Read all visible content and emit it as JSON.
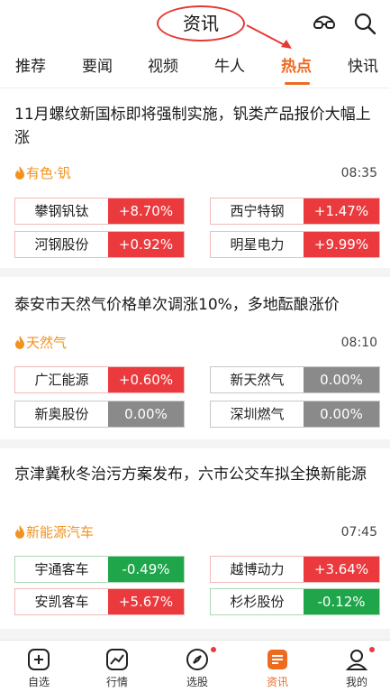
{
  "header": {
    "title": "资讯"
  },
  "tabs": [
    {
      "label": "推荐"
    },
    {
      "label": "要闻"
    },
    {
      "label": "视频"
    },
    {
      "label": "牛人"
    },
    {
      "label": "热点"
    },
    {
      "label": "快讯"
    }
  ],
  "news": [
    {
      "title": "11月螺纹新国标即将强制实施，钒类产品报价大幅上涨",
      "tag": "有色·钒",
      "time": "08:35",
      "stocks": [
        {
          "name": "攀钢钒钛",
          "pct": "+8.70%"
        },
        {
          "name": "西宁特钢",
          "pct": "+1.47%"
        },
        {
          "name": "河钢股份",
          "pct": "+0.92%"
        },
        {
          "name": "明星电力",
          "pct": "+9.99%"
        }
      ]
    },
    {
      "title": "泰安市天然气价格单次调涨10%，多地酝酿涨价",
      "tag": "天然气",
      "time": "08:10",
      "stocks": [
        {
          "name": "广汇能源",
          "pct": "+0.60%"
        },
        {
          "name": "新天然气",
          "pct": "0.00%"
        },
        {
          "name": "新奥股份",
          "pct": "0.00%"
        },
        {
          "name": "深圳燃气",
          "pct": "0.00%"
        }
      ]
    },
    {
      "title": "京津冀秋冬治污方案发布，六市公交车拟全换新能源",
      "tag": "新能源汽车",
      "time": "07:45",
      "stocks": [
        {
          "name": "宇通客车",
          "pct": "-0.49%"
        },
        {
          "name": "越博动力",
          "pct": "+3.64%"
        },
        {
          "name": "安凯客车",
          "pct": "+5.67%"
        },
        {
          "name": "杉杉股份",
          "pct": "-0.12%"
        }
      ]
    }
  ],
  "nav": [
    {
      "label": "自选"
    },
    {
      "label": "行情"
    },
    {
      "label": "选股"
    },
    {
      "label": "资讯"
    },
    {
      "label": "我的"
    }
  ],
  "colors": {
    "accent": "#ee6a1f",
    "up": "#ea3a3e",
    "down": "#1fa64b",
    "flat": "#8a8a8a"
  }
}
